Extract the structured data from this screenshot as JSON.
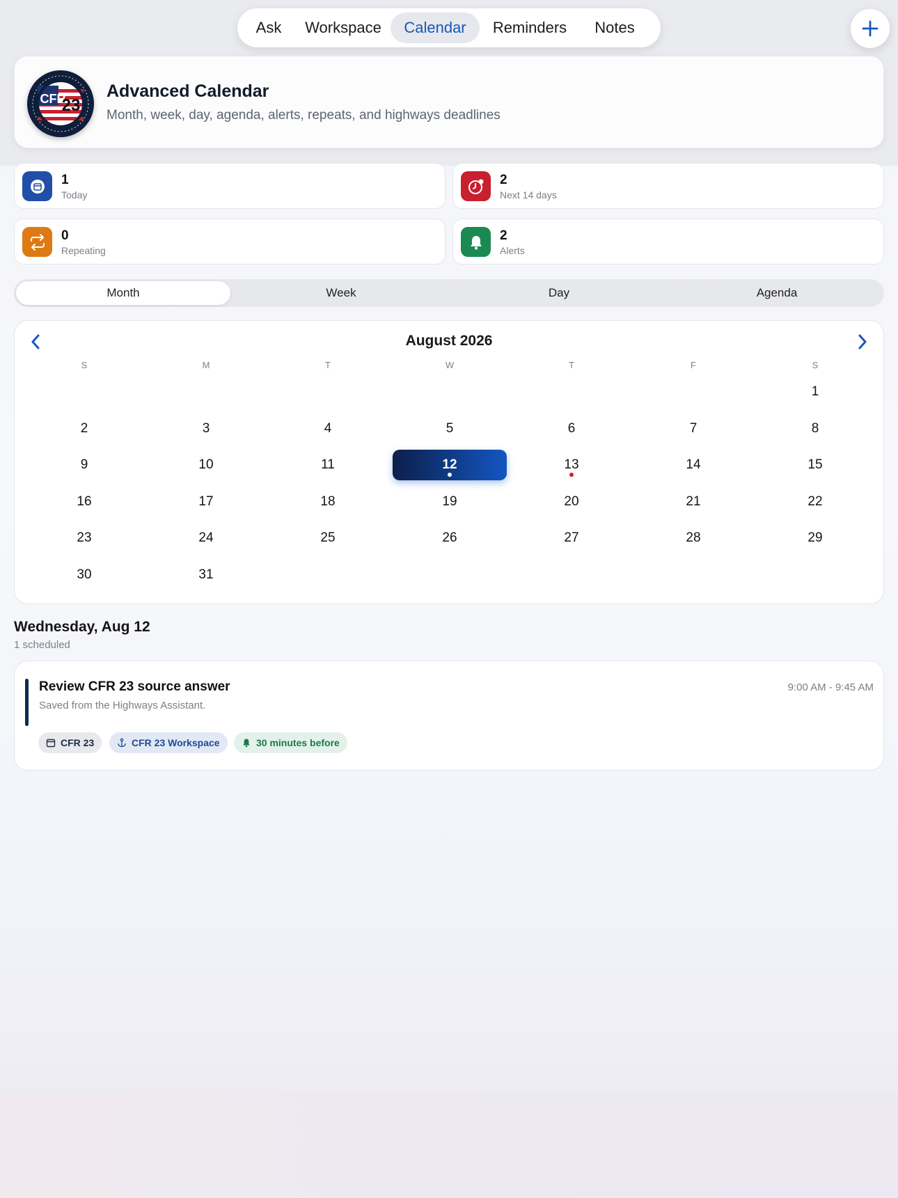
{
  "nav": {
    "tabs": [
      {
        "label": "Ask"
      },
      {
        "label": "Workspace"
      },
      {
        "label": "Calendar",
        "active": true
      },
      {
        "label": "Reminders"
      },
      {
        "label": "Notes"
      }
    ],
    "add_icon": "plus-icon"
  },
  "header": {
    "logo_text": "CFR 23",
    "title": "Advanced Calendar",
    "subtitle": "Month, week, day, agenda, alerts, repeats, and highways deadlines"
  },
  "stats": [
    {
      "value": "1",
      "label": "Today",
      "icon": "calendar-icon",
      "color": "#1f4fa8"
    },
    {
      "value": "2",
      "label": "Next 14 days",
      "icon": "clock-alert-icon",
      "color": "#c8202f"
    },
    {
      "value": "0",
      "label": "Repeating",
      "icon": "repeat-icon",
      "color": "#dd7a14"
    },
    {
      "value": "2",
      "label": "Alerts",
      "icon": "bell-icon",
      "color": "#1b8a52"
    }
  ],
  "view_modes": [
    {
      "label": "Month",
      "active": true
    },
    {
      "label": "Week"
    },
    {
      "label": "Day"
    },
    {
      "label": "Agenda"
    }
  ],
  "calendar": {
    "month_title": "August 2026",
    "weekdays": [
      "S",
      "M",
      "T",
      "W",
      "T",
      "F",
      "S"
    ],
    "first_weekday_index": 6,
    "days_in_month": 31,
    "selected_day": 12,
    "event_days": [
      {
        "day": 12,
        "dot_color": "#ffffff"
      },
      {
        "day": 13,
        "dot_color": "#c8202f"
      }
    ]
  },
  "selected_day": {
    "heading": "Wednesday, Aug 12",
    "count_text": "1 scheduled"
  },
  "event": {
    "title": "Review CFR 23 source answer",
    "description": "Saved from the Highways Assistant.",
    "time": "9:00 AM - 9:45 AM",
    "chips": [
      {
        "label": "CFR 23",
        "icon": "calendar-icon"
      },
      {
        "label": "CFR 23 Workspace",
        "icon": "anchor-icon"
      },
      {
        "label": "30 minutes before",
        "icon": "bell-icon"
      }
    ]
  }
}
